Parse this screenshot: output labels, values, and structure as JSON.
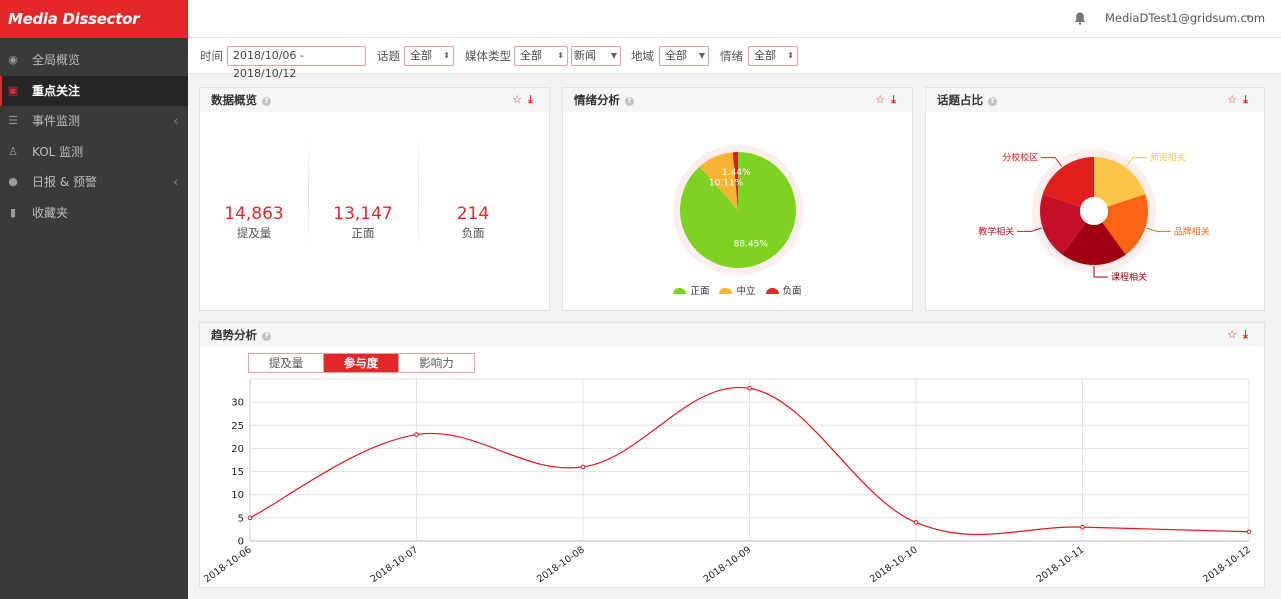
{
  "app": {
    "brand": "Media Dissector"
  },
  "sidebar": {
    "items": [
      {
        "label": "全局概览",
        "icon": "globe-icon",
        "active": false,
        "caret": ""
      },
      {
        "label": "重点关注",
        "icon": "focus-icon",
        "active": true,
        "caret": ""
      },
      {
        "label": "事件监测",
        "icon": "event-list-icon",
        "active": false,
        "caret": "‹"
      },
      {
        "label": "KOL 监测",
        "icon": "user-icon",
        "active": false,
        "caret": ""
      },
      {
        "label": "日报 & 预警",
        "icon": "bell-icon",
        "active": false,
        "caret": "‹"
      },
      {
        "label": "收藏夹",
        "icon": "bookmark-icon",
        "active": false,
        "caret": ""
      }
    ]
  },
  "topbar": {
    "user": "MediaDTest1@gridsum.com",
    "user_caret": "▾"
  },
  "filters": {
    "time_label": "时间",
    "time_value": "2018/10/06 - 2018/10/12",
    "topic_label": "话题",
    "topic_value": "全部",
    "media_label": "媒体类型",
    "media_value": "全部",
    "media_sub_value": "新闻",
    "region_label": "地域",
    "region_value": "全部",
    "sentiment_label": "情绪",
    "sentiment_value": "全部"
  },
  "overview": {
    "title": "数据概览",
    "stats": [
      {
        "value": "14,863",
        "label": "提及量"
      },
      {
        "value": "13,147",
        "label": "正面"
      },
      {
        "value": "214",
        "label": "负面"
      }
    ]
  },
  "sentiment": {
    "title": "情绪分析",
    "legend": [
      {
        "label": "正面",
        "color": "#7ed321"
      },
      {
        "label": "中立",
        "color": "#f8b334"
      },
      {
        "label": "负面",
        "color": "#e4282a"
      }
    ]
  },
  "topics": {
    "title": "话题占比"
  },
  "trend": {
    "title": "趋势分析",
    "tabs": [
      {
        "label": "提及量",
        "active": false
      },
      {
        "label": "参与度",
        "active": true
      },
      {
        "label": "影响力",
        "active": false
      }
    ]
  },
  "chart_data": [
    {
      "type": "pie",
      "title": "",
      "labels": [
        "正面",
        "中立",
        "负面"
      ],
      "values": [
        88.45,
        10.11,
        1.44
      ],
      "value_labels": [
        "88.45%",
        "10.11%",
        "1.44%"
      ],
      "colors": [
        "#7ed321",
        "#f8b334",
        "#e8141e"
      ]
    },
    {
      "type": "pie",
      "title": "",
      "labels": [
        "师资相关",
        "品牌相关",
        "课程相关",
        "教学相关",
        "分校校区"
      ],
      "values": [
        20,
        20,
        20,
        20,
        20
      ],
      "colors": [
        "#fdc64b",
        "#fb6414",
        "#a00010",
        "#c5102a",
        "#e0201e"
      ]
    },
    {
      "type": "line",
      "title": "",
      "x": [
        "2018-10-06",
        "2018-10-07",
        "2018-10-08",
        "2018-10-09",
        "2018-10-10",
        "2018-10-11",
        "2018-10-12"
      ],
      "series": [
        {
          "values": [
            5,
            23,
            16,
            33,
            4,
            3,
            2
          ],
          "color": "#e8141e"
        }
      ],
      "ylim": [
        0,
        35
      ],
      "yticks": [
        0,
        5,
        10,
        15,
        20,
        25,
        30
      ],
      "grid": true
    }
  ]
}
